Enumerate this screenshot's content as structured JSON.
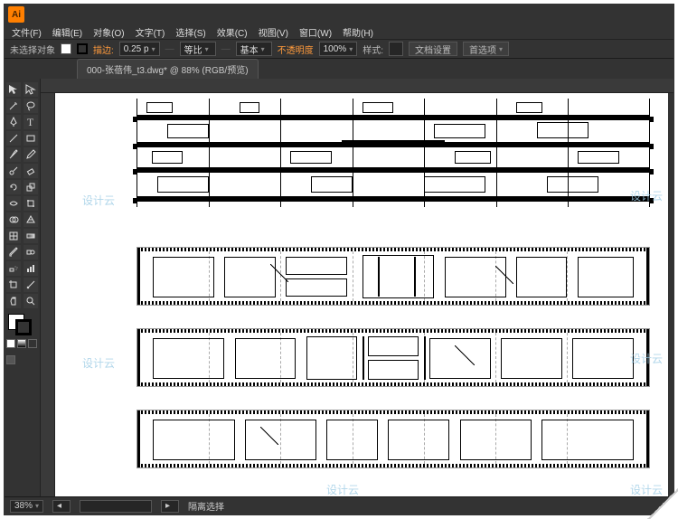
{
  "app": {
    "logo": "Ai"
  },
  "menu": {
    "file": "文件(F)",
    "edit": "编辑(E)",
    "object": "对象(O)",
    "type": "文字(T)",
    "select": "选择(S)",
    "effect": "效果(C)",
    "view": "视图(V)",
    "window": "窗口(W)",
    "help": "帮助(H)"
  },
  "control": {
    "selection": "未选择对象",
    "stroke_label": "描边:",
    "stroke_value": "0.25 p",
    "uniform": "等比",
    "basic": "基本",
    "opacity_label": "不透明度",
    "opacity_value": "100%",
    "style": "样式:",
    "doc_setup": "文档设置",
    "preferences": "首选项"
  },
  "tab": {
    "title": "000-张蓓伟_t3.dwg* @ 88% (RGB/预览)"
  },
  "status": {
    "zoom": "38%",
    "isolation": "隔离选择"
  },
  "watermark": {
    "text": "设计云"
  },
  "tools": [
    "selection",
    "direct-selection",
    "magic-wand",
    "lasso",
    "pen",
    "type",
    "line",
    "rectangle",
    "paintbrush",
    "pencil",
    "blob",
    "eraser",
    "rotate",
    "scale",
    "width",
    "free-transform",
    "shape-builder",
    "perspective",
    "mesh",
    "gradient",
    "eyedropper",
    "blend",
    "symbol-sprayer",
    "graph",
    "artboard",
    "slice",
    "hand",
    "zoom"
  ]
}
